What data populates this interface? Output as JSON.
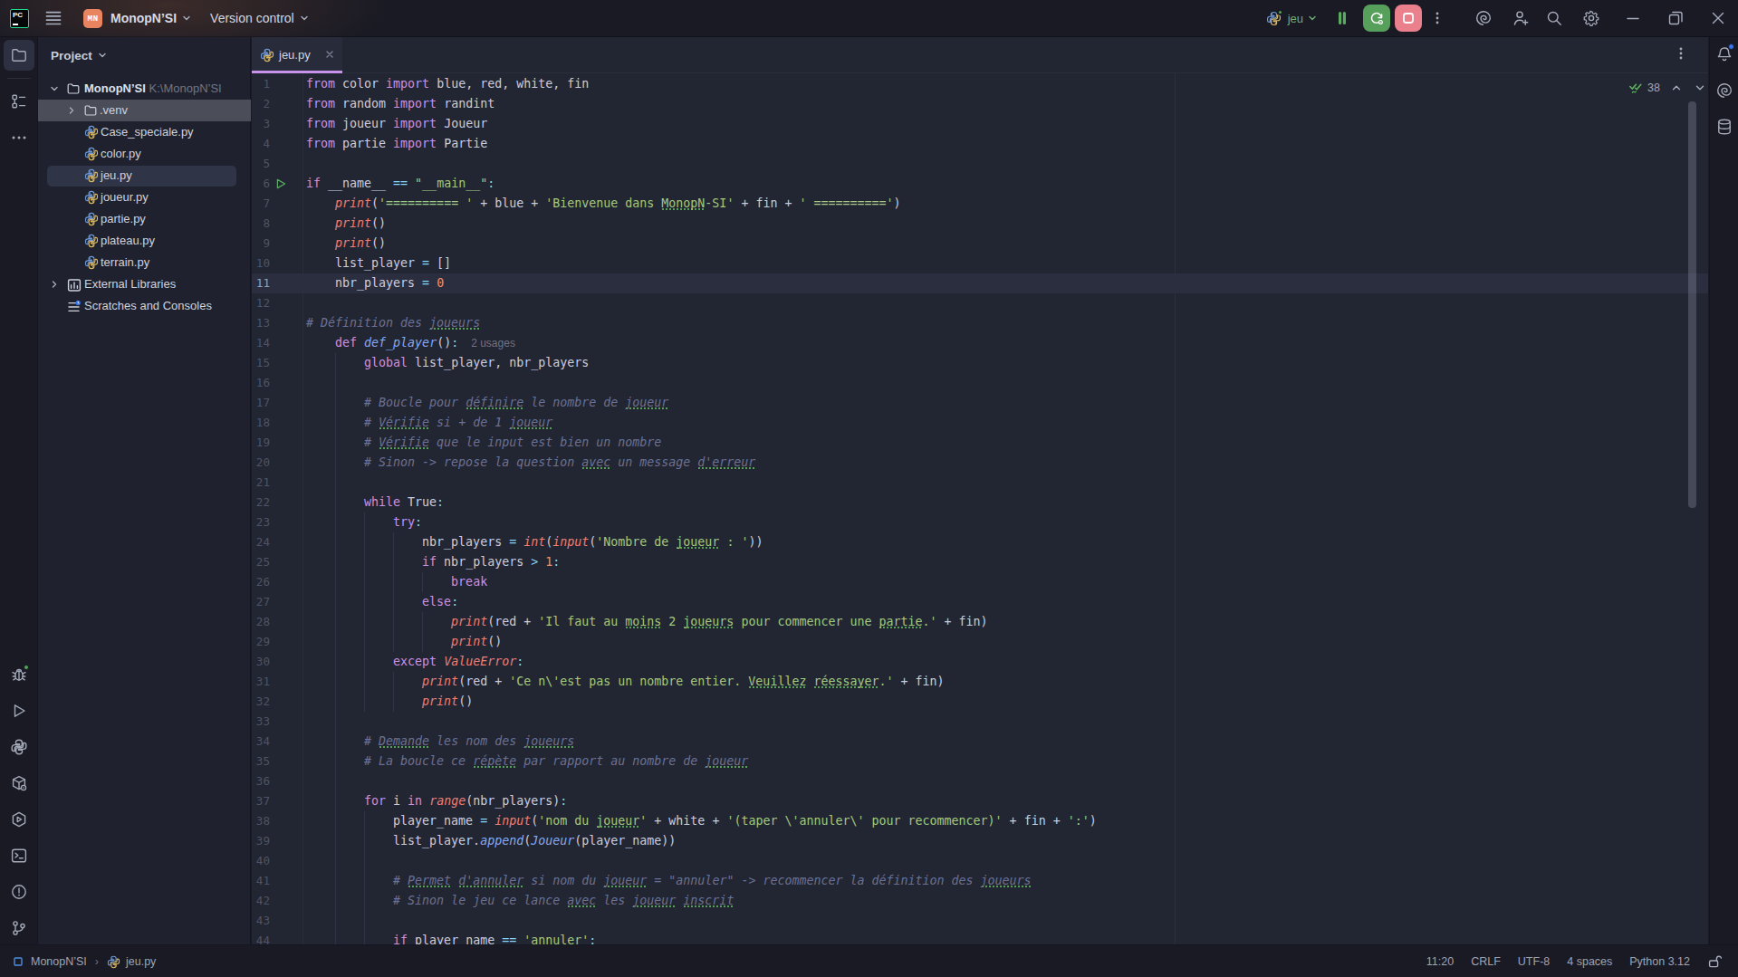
{
  "colors": {
    "accent_tab": "#C792EA",
    "run_green": "#57A05C",
    "stop_red": "#E9808B",
    "project_badge_orange": "#E8845F",
    "notification_blue": "#3574F0",
    "typo_squiggle_green": "#55A054"
  },
  "title_bar": {
    "app_logo": "PC",
    "project_badge": "MN",
    "project_name": "MonopN’SI",
    "vcs_label": "Version control",
    "run_config": "jeu"
  },
  "left_stripe": {
    "top": [
      {
        "id": "project-folder",
        "active": true
      },
      {
        "id": "structure",
        "active": false
      },
      {
        "id": "more-tools",
        "active": false
      }
    ],
    "bottom": [
      {
        "id": "debug",
        "badge": true
      },
      {
        "id": "run",
        "badge": false
      },
      {
        "id": "python-console",
        "badge": false
      },
      {
        "id": "python-packages",
        "badge": false
      },
      {
        "id": "services",
        "badge": false
      },
      {
        "id": "terminal",
        "badge": false
      },
      {
        "id": "problems",
        "badge": false
      },
      {
        "id": "version-control",
        "badge": false
      }
    ]
  },
  "project_panel": {
    "header": "Project",
    "tree": [
      {
        "label": "MonopN’SI",
        "path": " K:\\MonopN’SI",
        "icon": "folder",
        "level": 0,
        "chevron": "down",
        "bold": true
      },
      {
        "label": ".venv",
        "icon": "folder",
        "level": 1,
        "chevron": "right",
        "state": "hover"
      },
      {
        "label": "Case_speciale.py",
        "icon": "python",
        "level": 2
      },
      {
        "label": "color.py",
        "icon": "python",
        "level": 2
      },
      {
        "label": "jeu.py",
        "icon": "python",
        "level": 2,
        "state": "selected"
      },
      {
        "label": "joueur.py",
        "icon": "python",
        "level": 2
      },
      {
        "label": "partie.py",
        "icon": "python",
        "level": 2
      },
      {
        "label": "plateau.py",
        "icon": "python",
        "level": 2
      },
      {
        "label": "terrain.py",
        "icon": "python",
        "level": 2
      },
      {
        "label": "External Libraries",
        "icon": "library",
        "level": 0,
        "chevron": "right"
      },
      {
        "label": "Scratches and Consoles",
        "icon": "scratches",
        "level": 0
      }
    ]
  },
  "editor": {
    "tab": {
      "label": "jeu.py",
      "icon": "python"
    },
    "inspections": {
      "count": "38"
    },
    "caret_line": 11,
    "run_line": 6,
    "lines": [
      {
        "n": 1,
        "t": [
          [
            "kw",
            "from"
          ],
          [
            "d",
            " color "
          ],
          [
            "kw",
            "import"
          ],
          [
            "d",
            " blue, red, white, fin"
          ]
        ]
      },
      {
        "n": 2,
        "t": [
          [
            "kw",
            "from"
          ],
          [
            "d",
            " random "
          ],
          [
            "kw",
            "import"
          ],
          [
            "d",
            " randint"
          ]
        ]
      },
      {
        "n": 3,
        "t": [
          [
            "kw",
            "from"
          ],
          [
            "d",
            " joueur "
          ],
          [
            "kw",
            "import"
          ],
          [
            "d",
            " Joueur"
          ]
        ]
      },
      {
        "n": 4,
        "t": [
          [
            "kw",
            "from"
          ],
          [
            "d",
            " partie "
          ],
          [
            "kw",
            "import"
          ],
          [
            "d",
            " Partie"
          ]
        ]
      },
      {
        "n": 5,
        "t": []
      },
      {
        "n": 6,
        "run": true,
        "t": [
          [
            "kw",
            "if"
          ],
          [
            "d",
            " __name__ "
          ],
          [
            "o",
            "=="
          ],
          [
            "d",
            " "
          ],
          [
            "s",
            "\"__main__\""
          ],
          [
            "o",
            ":"
          ]
        ]
      },
      {
        "n": 7,
        "t": [
          [
            "d",
            "    "
          ],
          [
            "bi",
            "print"
          ],
          [
            "d",
            "("
          ],
          [
            "s",
            "'========== '"
          ],
          [
            "d",
            " + blue + "
          ],
          [
            "s",
            "'Bienvenue dans "
          ],
          [
            "s",
            "MonopN",
            1
          ],
          [
            "s",
            "-SI'"
          ],
          [
            "d",
            " + fin + "
          ],
          [
            "s",
            "' =========='"
          ],
          [
            "d",
            ")"
          ]
        ]
      },
      {
        "n": 8,
        "t": [
          [
            "d",
            "    "
          ],
          [
            "bi",
            "print"
          ],
          [
            "d",
            "()"
          ]
        ]
      },
      {
        "n": 9,
        "t": [
          [
            "d",
            "    "
          ],
          [
            "bi",
            "print"
          ],
          [
            "d",
            "()"
          ]
        ]
      },
      {
        "n": 10,
        "t": [
          [
            "d",
            "    list_player "
          ],
          [
            "o",
            "="
          ],
          [
            "d",
            " []"
          ]
        ]
      },
      {
        "n": 11,
        "cur": true,
        "t": [
          [
            "d",
            "    nbr_players "
          ],
          [
            "o",
            "="
          ],
          [
            "d",
            " "
          ],
          [
            "n",
            "0"
          ]
        ]
      },
      {
        "n": 12,
        "t": []
      },
      {
        "n": 13,
        "t": [
          [
            "c",
            "# Définition des "
          ],
          [
            "c",
            "joueurs",
            1
          ]
        ]
      },
      {
        "n": 14,
        "inlay": "2 usages",
        "t": [
          [
            "d",
            "    "
          ],
          [
            "kw",
            "def"
          ],
          [
            "d",
            " "
          ],
          [
            "fn",
            "def_player"
          ],
          [
            "d",
            "()"
          ],
          [
            "o",
            ":"
          ]
        ]
      },
      {
        "n": 15,
        "t": [
          [
            "d",
            "        "
          ],
          [
            "kw",
            "global"
          ],
          [
            "d",
            " list_player, nbr_players"
          ]
        ]
      },
      {
        "n": 16,
        "t": []
      },
      {
        "n": 17,
        "t": [
          [
            "d",
            "        "
          ],
          [
            "c",
            "# Boucle pour "
          ],
          [
            "c",
            "définire",
            1
          ],
          [
            "c",
            " le nombre de "
          ],
          [
            "c",
            "joueur",
            1
          ]
        ]
      },
      {
        "n": 18,
        "t": [
          [
            "d",
            "        "
          ],
          [
            "c",
            "# "
          ],
          [
            "c",
            "Vérifie",
            1
          ],
          [
            "c",
            " si + de 1 "
          ],
          [
            "c",
            "joueur",
            1
          ]
        ]
      },
      {
        "n": 19,
        "t": [
          [
            "d",
            "        "
          ],
          [
            "c",
            "# "
          ],
          [
            "c",
            "Vérifie",
            1
          ],
          [
            "c",
            " que le input est bien un nombre"
          ]
        ]
      },
      {
        "n": 20,
        "t": [
          [
            "d",
            "        "
          ],
          [
            "c",
            "# Sinon -> repose la question "
          ],
          [
            "c",
            "avec",
            1
          ],
          [
            "c",
            " un message "
          ],
          [
            "c",
            "d'erreur",
            1
          ]
        ]
      },
      {
        "n": 21,
        "t": []
      },
      {
        "n": 22,
        "t": [
          [
            "d",
            "        "
          ],
          [
            "kw",
            "while"
          ],
          [
            "d",
            " True"
          ],
          [
            "o",
            ":"
          ]
        ]
      },
      {
        "n": 23,
        "t": [
          [
            "d",
            "            "
          ],
          [
            "kw",
            "try"
          ],
          [
            "o",
            ":"
          ]
        ]
      },
      {
        "n": 24,
        "t": [
          [
            "d",
            "                nbr_players "
          ],
          [
            "o",
            "="
          ],
          [
            "d",
            " "
          ],
          [
            "bi",
            "int"
          ],
          [
            "d",
            "("
          ],
          [
            "bi",
            "input"
          ],
          [
            "d",
            "("
          ],
          [
            "s",
            "'Nombre de "
          ],
          [
            "s",
            "joueur",
            1
          ],
          [
            "s",
            " : '"
          ],
          [
            "d",
            "))"
          ]
        ]
      },
      {
        "n": 25,
        "t": [
          [
            "d",
            "                "
          ],
          [
            "kw",
            "if"
          ],
          [
            "d",
            " nbr_players "
          ],
          [
            "o",
            ">"
          ],
          [
            "d",
            " "
          ],
          [
            "n",
            "1"
          ],
          [
            "o",
            ":"
          ]
        ]
      },
      {
        "n": 26,
        "t": [
          [
            "d",
            "                    "
          ],
          [
            "kw",
            "break"
          ]
        ]
      },
      {
        "n": 27,
        "t": [
          [
            "d",
            "                "
          ],
          [
            "kw",
            "else"
          ],
          [
            "o",
            ":"
          ]
        ]
      },
      {
        "n": 28,
        "t": [
          [
            "d",
            "                    "
          ],
          [
            "bi",
            "print"
          ],
          [
            "d",
            "(red + "
          ],
          [
            "s",
            "'Il faut au "
          ],
          [
            "s",
            "moins",
            1
          ],
          [
            "s",
            " 2 "
          ],
          [
            "s",
            "joueurs",
            1
          ],
          [
            "s",
            " pour commencer une "
          ],
          [
            "s",
            "partie",
            1
          ],
          [
            "s",
            ".'"
          ],
          [
            "d",
            " + fin)"
          ]
        ]
      },
      {
        "n": 29,
        "t": [
          [
            "d",
            "                    "
          ],
          [
            "bi",
            "print"
          ],
          [
            "d",
            "()"
          ]
        ]
      },
      {
        "n": 30,
        "t": [
          [
            "d",
            "            "
          ],
          [
            "kw",
            "except"
          ],
          [
            "d",
            " "
          ],
          [
            "bi",
            "ValueError"
          ],
          [
            "o",
            ":"
          ]
        ]
      },
      {
        "n": 31,
        "t": [
          [
            "d",
            "                "
          ],
          [
            "bi",
            "print"
          ],
          [
            "d",
            "(red + "
          ],
          [
            "s",
            "'Ce n\\'est pas un nombre entier. "
          ],
          [
            "s",
            "Veuillez",
            1
          ],
          [
            "s",
            " "
          ],
          [
            "s",
            "réessayer",
            1
          ],
          [
            "s",
            ".'"
          ],
          [
            "d",
            " + fin)"
          ]
        ]
      },
      {
        "n": 32,
        "t": [
          [
            "d",
            "                "
          ],
          [
            "bi",
            "print"
          ],
          [
            "d",
            "()"
          ]
        ]
      },
      {
        "n": 33,
        "t": []
      },
      {
        "n": 34,
        "t": [
          [
            "d",
            "        "
          ],
          [
            "c",
            "# "
          ],
          [
            "c",
            "Demande",
            1
          ],
          [
            "c",
            " les nom des "
          ],
          [
            "c",
            "joueurs",
            1
          ]
        ]
      },
      {
        "n": 35,
        "t": [
          [
            "d",
            "        "
          ],
          [
            "c",
            "# La boucle ce "
          ],
          [
            "c",
            "répète",
            1
          ],
          [
            "c",
            " par rapport au nombre de "
          ],
          [
            "c",
            "joueur",
            1
          ]
        ]
      },
      {
        "n": 36,
        "t": []
      },
      {
        "n": 37,
        "t": [
          [
            "d",
            "        "
          ],
          [
            "kw",
            "for"
          ],
          [
            "d",
            " i "
          ],
          [
            "kw",
            "in"
          ],
          [
            "d",
            " "
          ],
          [
            "bi",
            "range"
          ],
          [
            "d",
            "(nbr_players)"
          ],
          [
            "o",
            ":"
          ]
        ]
      },
      {
        "n": 38,
        "t": [
          [
            "d",
            "            player_name "
          ],
          [
            "o",
            "="
          ],
          [
            "d",
            " "
          ],
          [
            "bi",
            "input"
          ],
          [
            "d",
            "("
          ],
          [
            "s",
            "'nom du "
          ],
          [
            "s",
            "joueur",
            1
          ],
          [
            "s",
            "'"
          ],
          [
            "d",
            " + white + "
          ],
          [
            "s",
            "'(taper \\'annuler\\' pour recommencer)'"
          ],
          [
            "d",
            " + fin + "
          ],
          [
            "s",
            "':'"
          ],
          [
            "d",
            ")"
          ]
        ]
      },
      {
        "n": 39,
        "t": [
          [
            "d",
            "            list_player."
          ],
          [
            "fn",
            "append"
          ],
          [
            "d",
            "("
          ],
          [
            "fn",
            "Joueur"
          ],
          [
            "d",
            "(player_name))"
          ]
        ]
      },
      {
        "n": 40,
        "t": []
      },
      {
        "n": 41,
        "t": [
          [
            "d",
            "            "
          ],
          [
            "c",
            "# "
          ],
          [
            "c",
            "Permet",
            1
          ],
          [
            "c",
            " "
          ],
          [
            "c",
            "d'annuler",
            1
          ],
          [
            "c",
            " si nom du "
          ],
          [
            "c",
            "joueur",
            1
          ],
          [
            "c",
            " = \"annuler\" -> recommencer la définition des "
          ],
          [
            "c",
            "joueurs",
            1
          ]
        ]
      },
      {
        "n": 42,
        "t": [
          [
            "d",
            "            "
          ],
          [
            "c",
            "# Sinon le jeu ce lance "
          ],
          [
            "c",
            "avec",
            1
          ],
          [
            "c",
            " les "
          ],
          [
            "c",
            "joueur",
            1
          ],
          [
            "c",
            " "
          ],
          [
            "c",
            "inscrit",
            1
          ]
        ]
      },
      {
        "n": 43,
        "t": []
      },
      {
        "n": 44,
        "t": [
          [
            "d",
            "            "
          ],
          [
            "kw",
            "if"
          ],
          [
            "d",
            " player_name "
          ],
          [
            "o",
            "=="
          ],
          [
            "d",
            " "
          ],
          [
            "s",
            "'annuler'"
          ],
          [
            "o",
            ":"
          ]
        ]
      }
    ]
  },
  "right_stripe": [
    {
      "id": "notifications",
      "badge": true
    },
    {
      "id": "ai-assistant",
      "badge": false
    },
    {
      "id": "database",
      "badge": false
    }
  ],
  "status_bar": {
    "project": "MonopN’SI",
    "separator": "›",
    "file": "jeu.py",
    "caret": "11:20",
    "line_ending": "CRLF",
    "encoding": "UTF-8",
    "indent": "4 spaces",
    "interpreter": "Python 3.12"
  }
}
